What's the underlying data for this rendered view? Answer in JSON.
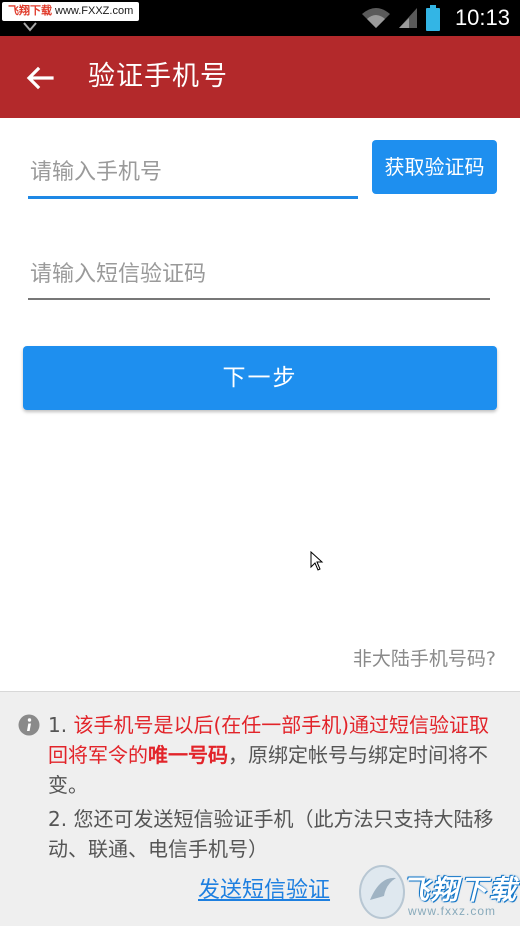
{
  "status_bar": {
    "watermark_brand": "飞翔下载",
    "watermark_url": "www.FXXZ.com",
    "time": "10:13"
  },
  "app_bar": {
    "title": "验证手机号"
  },
  "form": {
    "phone_placeholder": "请输入手机号",
    "phone_value": "",
    "code_placeholder": "请输入短信验证码",
    "code_value": "",
    "get_code_label": "获取验证码",
    "next_label": "下一步"
  },
  "overseas_link": "非大陆手机号码?",
  "notice": {
    "item1_prefix": "1. ",
    "item1_red": "该手机号是以后(在任一部手机)通过短信验证取回将军令的",
    "item1_bold": "唯一号码",
    "item1_rest": "，原绑定帐号与绑定时间将不变。",
    "item2": "2. 您还可发送短信验证手机（此方法只支持大陆移动、联通、电信手机号）",
    "sms_link": "发送短信验证"
  },
  "watermark_logo": {
    "name": "飞翔下载",
    "url": "www.fxxz.com"
  },
  "colors": {
    "app_bar": "#b3292b",
    "primary_button": "#1e8fef",
    "focus_underline": "#1e88e5",
    "notice_red": "#e2242a",
    "link": "#1d7fe0"
  },
  "icons": {
    "back": "arrow-left-icon",
    "info": "info-circle-icon",
    "wifi": "wifi-icon",
    "signal": "cell-signal-icon",
    "battery": "battery-icon",
    "download": "download-arrow-icon"
  }
}
